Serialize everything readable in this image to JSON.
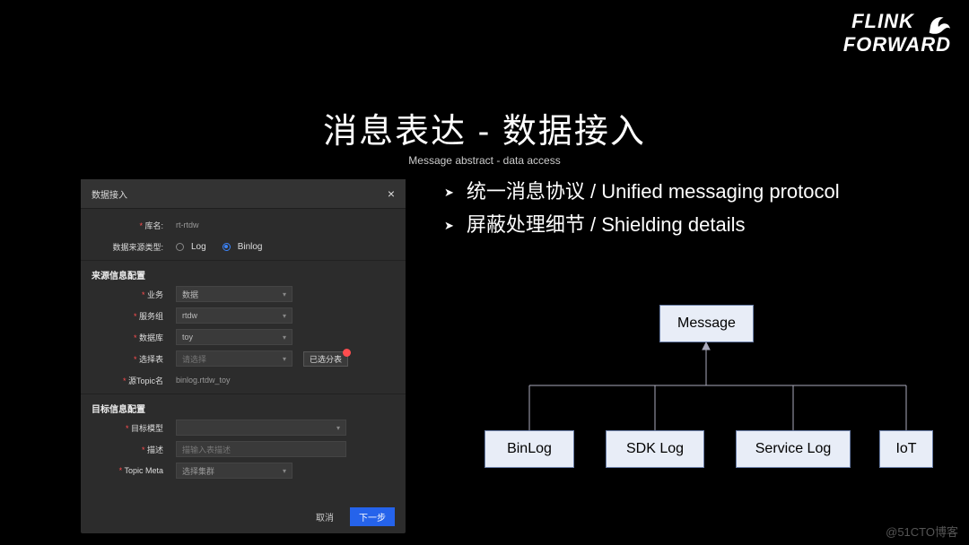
{
  "logo": {
    "line1": "FLINK",
    "line2": "FORWARD"
  },
  "title": "消息表达 - 数据接入",
  "subtitle": "Message abstract - data access",
  "bullets": [
    "统一消息协议 / Unified messaging protocol",
    "屏蔽处理细节 / Shielding details"
  ],
  "panel": {
    "title": "数据接入",
    "close": "×",
    "table_name_label": "库名:",
    "table_name_value": "rt-rtdw",
    "source_type_label": "数据来源类型:",
    "radio_log": "Log",
    "radio_binlog": "Binlog",
    "section_source": "来源信息配置",
    "field_biz": "业务",
    "field_biz_value": "数据",
    "field_svc_group": "服务组",
    "field_svc_group_value": "rtdw",
    "field_db": "数据库",
    "field_db_value": "toy",
    "field_select_table": "选择表",
    "field_select_table_placeholder": "请选择",
    "badge_selected": "已选分表",
    "field_src_topic": "源Topic名",
    "field_src_topic_value": "binlog.rtdw_toy",
    "section_target": "目标信息配置",
    "field_target_model": "目标模型",
    "field_desc": "描述",
    "field_desc_placeholder": "描输入表描述",
    "field_topic_meta": "Topic Meta",
    "field_topic_meta_value": "选择集群",
    "btn_cancel": "取消",
    "btn_next": "下一步"
  },
  "diagram": {
    "root": "Message",
    "children": [
      "BinLog",
      "SDK Log",
      "Service Log",
      "IoT"
    ]
  },
  "watermark": "@51CTO博客"
}
